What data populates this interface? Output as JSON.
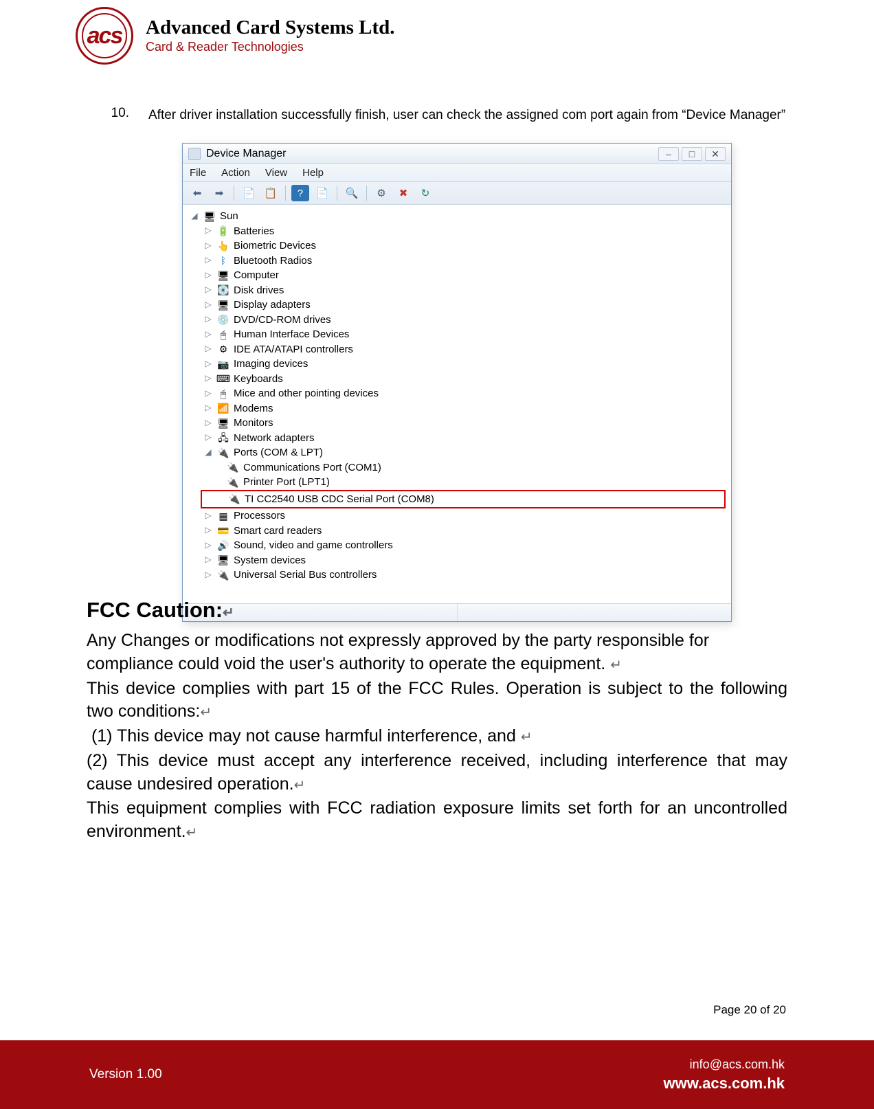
{
  "header": {
    "logo_text": "acs",
    "company_name": "Advanced Card Systems Ltd.",
    "company_tagline": "Card & Reader Technologies"
  },
  "step": {
    "number": "10.",
    "text": "After driver installation successfully finish, user can check the assigned com port again from “Device Manager”"
  },
  "device_manager": {
    "window_title": "Device Manager",
    "menus": {
      "file": "File",
      "action": "Action",
      "view": "View",
      "help": "Help"
    },
    "toolbar_icons": {
      "back": "back-icon",
      "forward": "forward-icon",
      "up_container": "up-container-icon",
      "show_hidden": "show-hidden-icon",
      "help": "help-icon",
      "properties": "properties-icon",
      "refresh": "refresh-icon",
      "update": "update-driver-icon",
      "uninstall": "uninstall-icon",
      "scan": "scan-hardware-icon"
    },
    "root": "Sun",
    "categories": {
      "batteries": "Batteries",
      "biometric": "Biometric Devices",
      "bluetooth": "Bluetooth Radios",
      "computer": "Computer",
      "disk": "Disk drives",
      "display": "Display adapters",
      "dvd": "DVD/CD-ROM drives",
      "hid": "Human Interface Devices",
      "ide": "IDE ATA/ATAPI controllers",
      "imaging": "Imaging devices",
      "keyboards": "Keyboards",
      "mice": "Mice and other pointing devices",
      "modems": "Modems",
      "monitors": "Monitors",
      "network": "Network adapters",
      "ports": "Ports (COM & LPT)",
      "processors": "Processors",
      "smartcard": "Smart card readers",
      "sound": "Sound, video and game controllers",
      "system": "System devices",
      "usb": "Universal Serial Bus controllers"
    },
    "ports_children": {
      "com1": "Communications Port (COM1)",
      "lpt1": "Printer Port (LPT1)",
      "ti": "TI CC2540 USB CDC Serial Port (COM8)"
    },
    "window_buttons": {
      "minimize": "–",
      "maximize": "□",
      "close": "✕"
    }
  },
  "fcc": {
    "heading": "FCC Caution:",
    "p1": "Any Changes or modifications not expressly approved by the party responsible for compliance could void the user's authority to operate the equipment.",
    "p2": "This device complies with part 15 of the FCC Rules. Operation is subject to the following two conditions:",
    "c1": "(1) This device may not cause harmful interference, and",
    "c2": "(2) This device must accept any interference received, including interference that may cause undesired operation.",
    "p3": "This equipment complies with FCC radiation exposure limits set forth for an uncontrolled environment.",
    "return_mark": "↵"
  },
  "footer": {
    "page_label": "Page 20 of 20",
    "version": "Version 1.00",
    "email": "info@acs.com.hk",
    "site": "www.acs.com.hk"
  }
}
